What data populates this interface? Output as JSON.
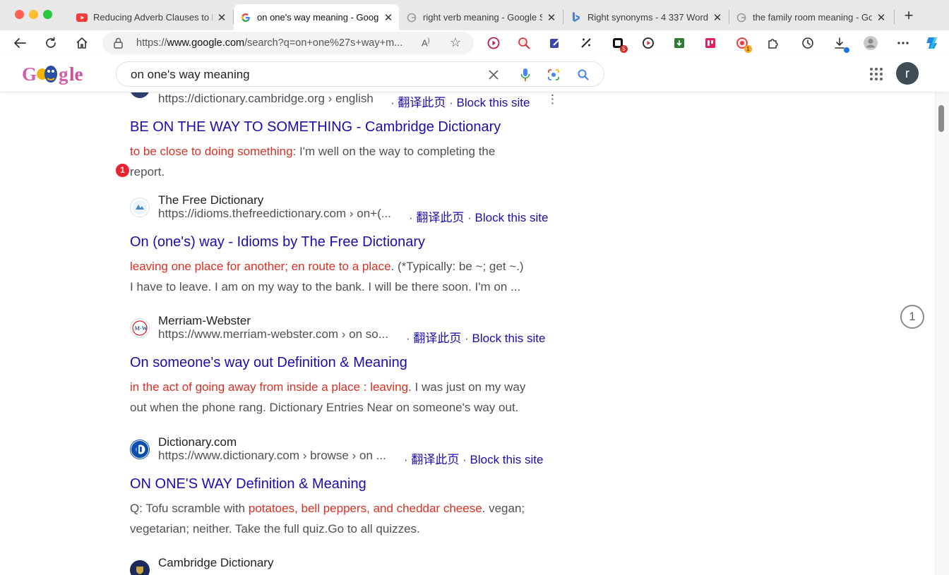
{
  "tabs": [
    {
      "title": "Reducing Adverb Clauses to P",
      "icon": "youtube-icon"
    },
    {
      "title": "on one's way meaning - Goog",
      "icon": "google-icon",
      "active": true
    },
    {
      "title": "right verb meaning - Google S",
      "icon": "google-icon"
    },
    {
      "title": "Right synonyms - 4 337 Words",
      "icon": "bing-icon"
    },
    {
      "title": "the family room meaning - Go",
      "icon": "google-icon"
    }
  ],
  "tab_close_glyph": "✕",
  "new_tab_glyph": "+",
  "address": {
    "scheme": "https://",
    "host": "www.google.com",
    "path": "/search?q=on+one%27s+way+m..."
  },
  "extension_badges": {
    "ext5": "5",
    "ext9": "1"
  },
  "google": {
    "query": "on one's way meaning",
    "avatar_letter": "r"
  },
  "results": [
    {
      "site_name": "",
      "url": "https://dictionary.cambridge.org › english",
      "translate": "翻译此页",
      "block": "Block this site",
      "title": "BE ON THE WAY TO SOMETHING - Cambridge Dictionary",
      "snippet_hl": "to be close to doing something",
      "snippet_rest": ": I'm well on the way to completing the",
      "snippet_line2": "report."
    },
    {
      "site_name": "The Free Dictionary",
      "url": "https://idioms.thefreedictionary.com › on+(...",
      "translate": "翻译此页",
      "block": "Block this site",
      "title": "On (one's) way - Idioms by The Free Dictionary",
      "snippet_hl": "leaving one place for another; en route to a place",
      "snippet_rest": ". (*Typically: be ~; get ~.)",
      "snippet_line2": "I have to leave. I am on my way to the bank. I will be there soon. I'm on ..."
    },
    {
      "site_name": "Merriam-Webster",
      "url": "https://www.merriam-webster.com › on so...",
      "translate": "翻译此页",
      "block": "Block this site",
      "title": "On someone's way out Definition & Meaning",
      "snippet_hl": "in the act of going away from inside a place : leaving",
      "snippet_rest": ". I was just on my way",
      "snippet_line2": "out when the phone rang. Dictionary Entries Near on someone's way out."
    },
    {
      "site_name": "Dictionary.com",
      "url": "https://www.dictionary.com › browse › on ...",
      "translate": "翻译此页",
      "block": "Block this site",
      "title": "ON ONE'S WAY Definition & Meaning",
      "snippet_pre": "Q: Tofu scramble with ",
      "snippet_hl": "potatoes, bell peppers, and cheddar cheese",
      "snippet_rest": ". vegan;",
      "snippet_line2": "vegetarian; neither. Take the full quiz.Go to all quizzes."
    },
    {
      "site_name": "Cambridge Dictionary"
    }
  ],
  "marker_number": "1",
  "page_badge": "1",
  "colors": {
    "link": "#1a0dab",
    "highlight": "#d93025",
    "avatar": "#3f4b55"
  }
}
